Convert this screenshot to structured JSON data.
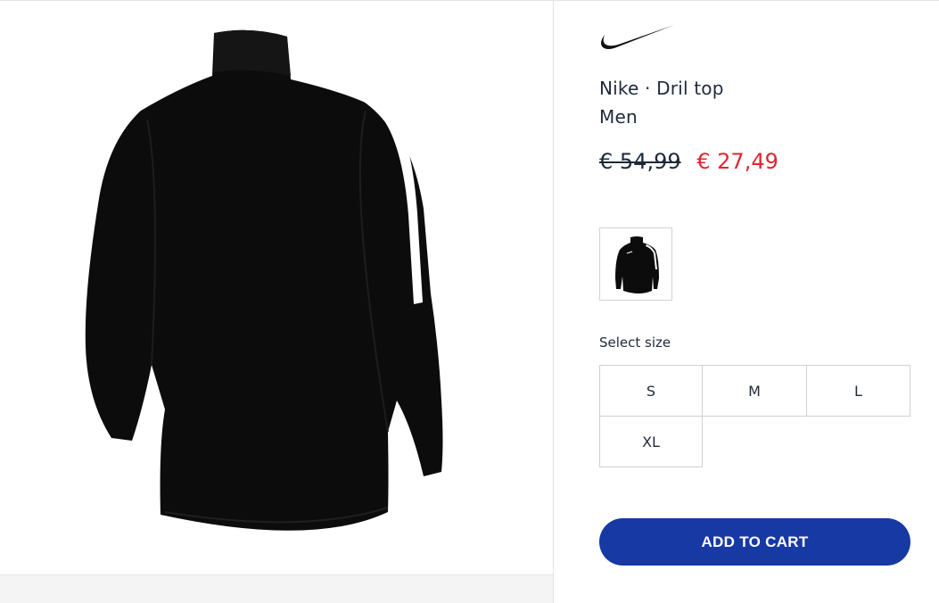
{
  "product": {
    "brand_line": "Nike · Dril top",
    "category": "Men",
    "price_old": "€ 54,99",
    "price_new": "€ 27,49",
    "price_new_color": "#e0262e",
    "image_icon": "long-sleeve-top-back-view"
  },
  "sizes": {
    "label": "Select size",
    "options": [
      "S",
      "M",
      "L",
      "XL"
    ]
  },
  "cart": {
    "button_label": "ADD TO CART",
    "button_color": "#1739a3"
  },
  "brand": {
    "logo": "swoosh-logo"
  }
}
